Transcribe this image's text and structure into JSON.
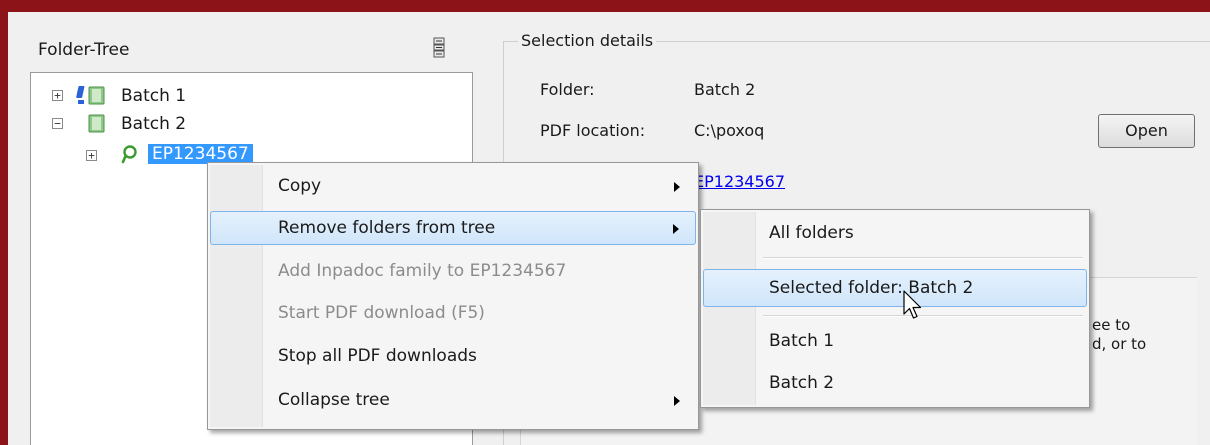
{
  "tree": {
    "title": "Folder-Tree",
    "nodes": [
      {
        "label": "Batch 1",
        "expander": "+"
      },
      {
        "label": "Batch 2",
        "expander": "−"
      },
      {
        "label": "EP1234567",
        "expander": "+"
      }
    ]
  },
  "details": {
    "group_title": "Selection details",
    "folder_label": "Folder:",
    "folder_value": "Batch 2",
    "pdf_label": "PDF location:",
    "pdf_value": "C:\\poxoq",
    "link_value": "EP1234567",
    "open_button": "Open",
    "partial_text_1": "ee to",
    "partial_text_2": "d, or to"
  },
  "context_menu": {
    "items": [
      {
        "label": "Copy",
        "has_submenu": true,
        "enabled": true
      },
      {
        "label": "Remove folders from tree",
        "has_submenu": true,
        "enabled": true,
        "highlighted": true
      },
      {
        "label": "Add Inpadoc family to EP1234567",
        "has_submenu": false,
        "enabled": false
      },
      {
        "label": "Start PDF download (F5)",
        "has_submenu": false,
        "enabled": false
      },
      {
        "label": "Stop all PDF downloads",
        "has_submenu": false,
        "enabled": true
      },
      {
        "label": "Collapse tree",
        "has_submenu": true,
        "enabled": true
      }
    ]
  },
  "submenu": {
    "items": [
      {
        "label": "All folders"
      },
      {
        "label": "Selected folder: Batch 2",
        "highlighted": true
      },
      {
        "label": "Batch 1"
      },
      {
        "label": "Batch 2"
      }
    ]
  },
  "colors": {
    "frame": "#8c1418",
    "selection": "#3399ff",
    "menu_highlight_border": "#7eb4ea",
    "link": "#0000ee"
  }
}
